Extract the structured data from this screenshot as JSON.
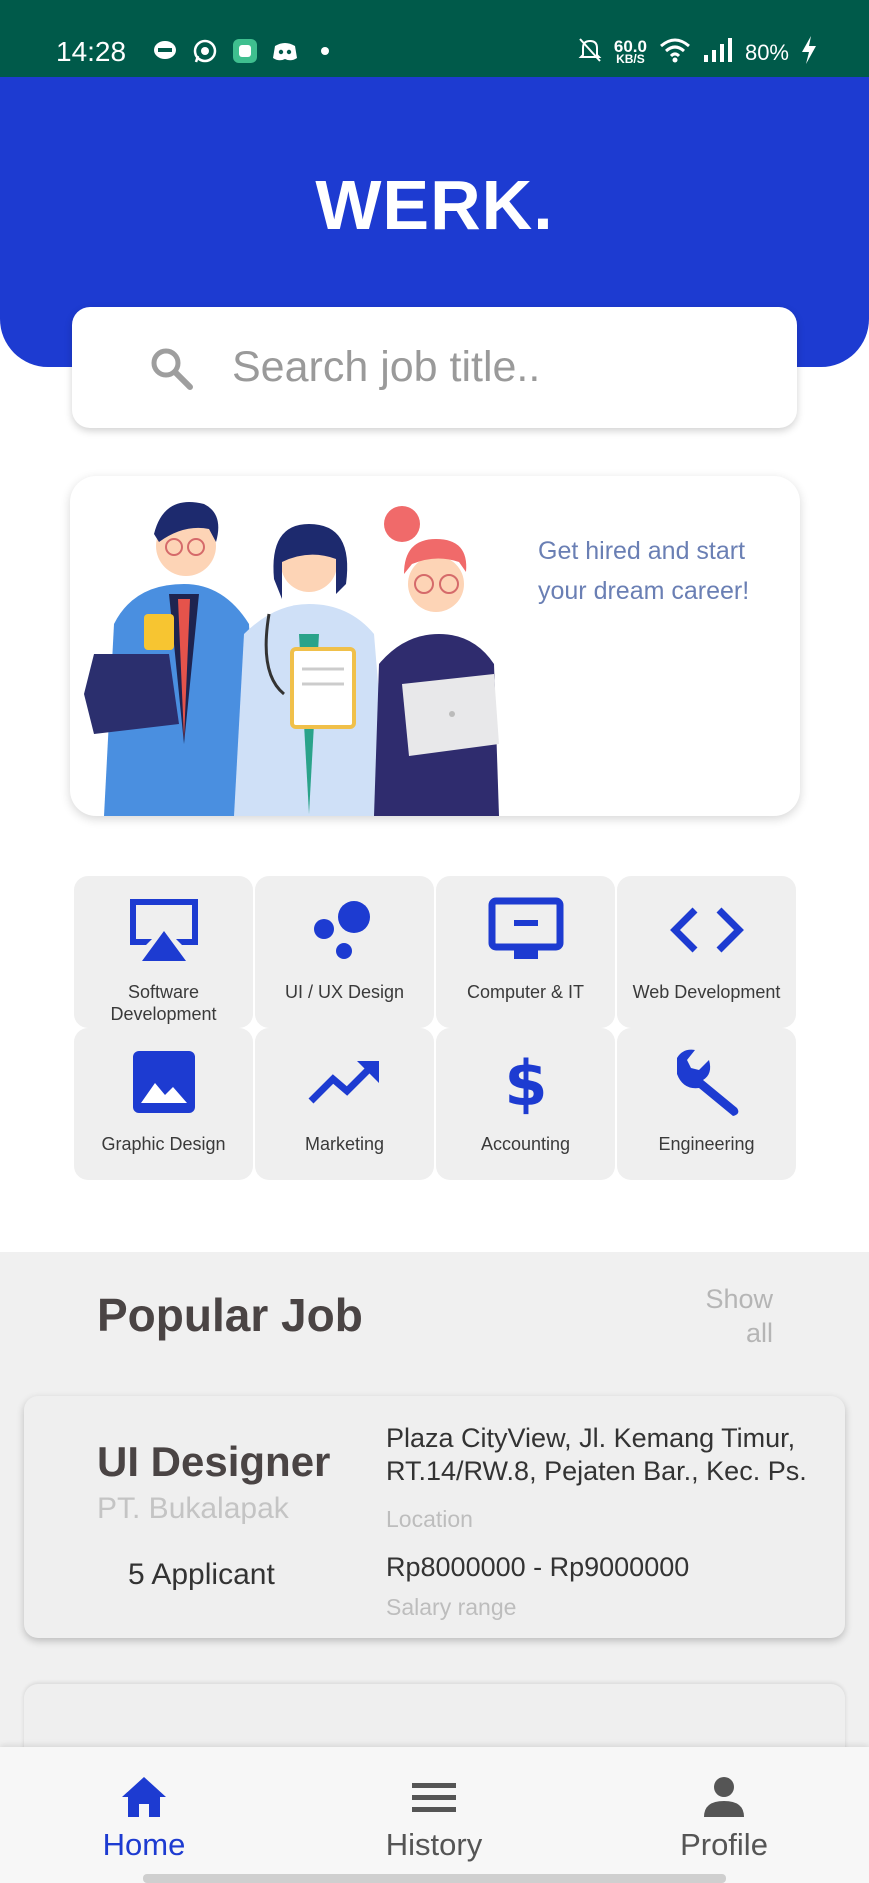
{
  "status_bar": {
    "time": "14:28",
    "net_speed_value": "60.0",
    "net_speed_unit": "KB/S",
    "battery": "80%",
    "left_icons": [
      "line-icon",
      "whatsapp-icon",
      "app-icon",
      "discord-icon",
      "dot-icon"
    ],
    "right_icons": [
      "mute-bell-icon",
      "wifi-icon",
      "signal-icon",
      "charging-icon"
    ]
  },
  "header": {
    "title": "WERK."
  },
  "search": {
    "placeholder": "Search job title..",
    "value": ""
  },
  "banner": {
    "text": "Get hired and start your dream career!"
  },
  "categories": [
    {
      "label": "Software Development",
      "icon": "airplay-icon"
    },
    {
      "label": "UI / UX Design",
      "icon": "bubble-chart-icon"
    },
    {
      "label": "Computer & IT",
      "icon": "monitor-icon"
    },
    {
      "label": "Web Development",
      "icon": "code-icon"
    },
    {
      "label": "Graphic Design",
      "icon": "image-icon"
    },
    {
      "label": "Marketing",
      "icon": "trending-up-icon"
    },
    {
      "label": "Accounting",
      "icon": "dollar-icon"
    },
    {
      "label": "Engineering",
      "icon": "wrench-icon"
    }
  ],
  "popular": {
    "title": "Popular Job",
    "show_all": "Show all",
    "jobs": [
      {
        "title": "UI Designer",
        "company": "PT. Bukalapak",
        "applicants": "5 Applicant",
        "location": "Plaza CityView, Jl. Kemang Timur, RT.14/RW.8, Pejaten Bar., Kec. Ps. Minggu, Kota Jakarta",
        "location_label": "Location",
        "salary": "Rp8000000 - Rp9000000",
        "salary_label": "Salary range"
      }
    ]
  },
  "bottom_nav": [
    {
      "label": "Home",
      "icon": "home-icon",
      "active": true
    },
    {
      "label": "History",
      "icon": "menu-icon",
      "active": false
    },
    {
      "label": "Profile",
      "icon": "person-icon",
      "active": false
    }
  ],
  "colors": {
    "brand": "#1d3bd1",
    "status_bar": "#005a4a",
    "surface": "#efefef"
  }
}
